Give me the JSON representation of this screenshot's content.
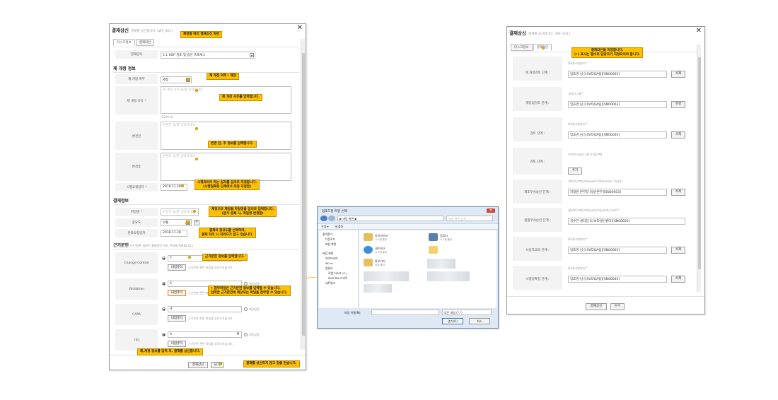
{
  "left_dialog": {
    "title": "결재상신",
    "subtitle": "결재를 상신합니다. [WF_001]",
    "tabs": [
      "타스크정보",
      "결재라인"
    ],
    "approval_type_label": "결재양식",
    "approval_type_value": "1.1 SOP 검토 및 승인 프로세스",
    "section_revision": "제 개정 정보",
    "revision_yn_label": "제 개정 여부",
    "revision_yn_value": "제정",
    "revision_reason_label": "제 개정 사유",
    "revision_reason_placeholder": "제 개정 사유 를/를 입력하세요",
    "revision_reason_limit": "(1000 자)",
    "before_label": "변경전",
    "before_placeholder": "변경전 을/를 입력하세요",
    "after_label": "변경후",
    "after_placeholder": "변경후 을/를 입력하세요",
    "effective_date_label": "시행요청일자",
    "effective_date_value": "2018.11.28",
    "section_approval": "결재정보",
    "file_label": "파일명",
    "file_placeholder": "파일명 을/를 입력하세요",
    "importance_label": "중요도",
    "importance_value": "보통",
    "due_date_label": "완료요청일자",
    "due_date_value": "2018.11.28",
    "section_basis": "근거문헌",
    "section_basis_hint": "(근거문헌 정보는 결재승인 이후, 문서에 적용됩니다.)",
    "basis_rows": [
      {
        "label": "Change Control",
        "value": "Y",
        "na": ""
      },
      {
        "label": "Validation",
        "value": "S",
        "na": "해당없음"
      },
      {
        "label": "CAPA",
        "value": "H",
        "na": "해당없음"
      },
      {
        "label": "기타",
        "value": "A",
        "na": "해당없음"
      }
    ],
    "attach_button": "내컴퓨터",
    "attach_hint": "근거문헌 관련 파일을 업로드하십시오.",
    "submit_button": "결재상신",
    "close_button": "닫기"
  },
  "file_dialog": {
    "title": "업로드할 파일 선택",
    "path": "▶ 바탕 화면 ▶",
    "search_placeholder": "바탕 화면 검색",
    "toolbar_left": "구성 ▾",
    "toolbar_new_folder": "새 폴더",
    "tree": [
      "즐겨찾기",
      "다운로드",
      "바탕 화면",
      "바탕 화면",
      "라이브러리",
      "SK hu",
      "컴퓨터",
      "로컬 디스크 (C:)",
      "DVD RW 드라이",
      "네트워크"
    ],
    "items": [
      {
        "name": "라이브러리",
        "sub": "시스템 폴더"
      },
      {
        "name": "컴퓨터",
        "sub": "시스템 폴더"
      },
      {
        "name": "네트워크",
        "sub": "시스템 폴더"
      },
      {
        "name": "바로가기",
        "sub": "파일 폴더"
      }
    ],
    "file_name_label": "파일 이름(N):",
    "file_type_value": "모든 파일 (*.*)",
    "open_button": "열기(O)",
    "cancel_button": "취소"
  },
  "right_dialog": {
    "title": "결재상신",
    "subtitle": "결재를 상신합니다. [WF_001]",
    "tabs": [
      "타스크정보",
      "결재라인"
    ],
    "rows": [
      {
        "label": "제 개정검토 단계 :",
        "role": "QA문서담당자 *",
        "value": "임효경 님 [나보타QA팀][SN00003]",
        "button": "삭제"
      },
      {
        "label": "해당팀검토 단계 :",
        "role": "접효지그룹 *",
        "value": "임효경 님 [나보타QA팀][SN00003]",
        "button": "변경"
      },
      {
        "label": "검토 단계 :",
        "role": "QA문서담당자 *",
        "value": "임효경 님 [나보타QA팀][SN00003]",
        "button": "삭제"
      },
      {
        "label": "검토 단계 :",
        "role": "관련부서담장그룹 (다중선택)",
        "value": "",
        "button": "추가"
      },
      {
        "label": "제조부서승인 단계 :",
        "role": "제조부서책임자(Head of Manufact. Dept.)",
        "value": "지정원 본부장 [생산본부][SN00003]",
        "button": "삭제"
      },
      {
        "label": "품질부서승인 단계 :",
        "role": "품질부서책임자(Head of Quality Unit) *",
        "value": "김수한 센터장 [나보타생산센터][SN00003]",
        "button": ""
      },
      {
        "label": "사용자교육 단계 :",
        "role": "QA문서담당자 *",
        "value": "임효경 님 [나보타QA팀][SN00003]",
        "button": "삭제"
      },
      {
        "label": "시행일확정 단계 :",
        "role": "QA문서담당자 *",
        "value": "임효경 님 [나보타QA팀][SN00003]",
        "button": "삭제"
      }
    ],
    "submit_button": "결재상신",
    "close_button": "닫기"
  },
  "callouts": {
    "c1": "제정할 때의 결재상신 화면",
    "c2": "제 개정 여부 : 제정",
    "c3": "제 개정 사유를 입력합니다.",
    "c4": "변경 전, 후 정보를 입력합니다.",
    "c5a": "시행되어야 하는 일자를 임의로 지정합니다.",
    "c5b": "(시행일확정 단계에서 최종 지정함)",
    "c6a": "제정으로 제정될 파일명을 임의로 입력합니다.",
    "c6b": "(문서 등록 시, 파일명 변경함)",
    "c7a": "결재의 중요도를 선택하며,",
    "c7b": "결재 처리 시 처리자가 알고 있습니다.",
    "c8": "근거문헌 정보를 입력합니다.",
    "c9a": "• 첨부파일은 근거문헌 정보를 입력할 수 있습니다.",
    "c9b": "  입력한 근거문헌에 해당되는 파일을 첨부할 수 있습니다.",
    "c10": "제,개정 정보를 입력 후, 결재를 상신합니다.",
    "c11": "결재를 상신하지 않고 창을 닫습니다.",
    "c12a": "결재라인을 지정합니다.",
    "c12b": "(•) 표시는 필수로 담당자가 지정되어야 합니다."
  },
  "colors": {
    "callout": "#ffc000",
    "connector": "#f0b400",
    "required": "#e05b00"
  }
}
